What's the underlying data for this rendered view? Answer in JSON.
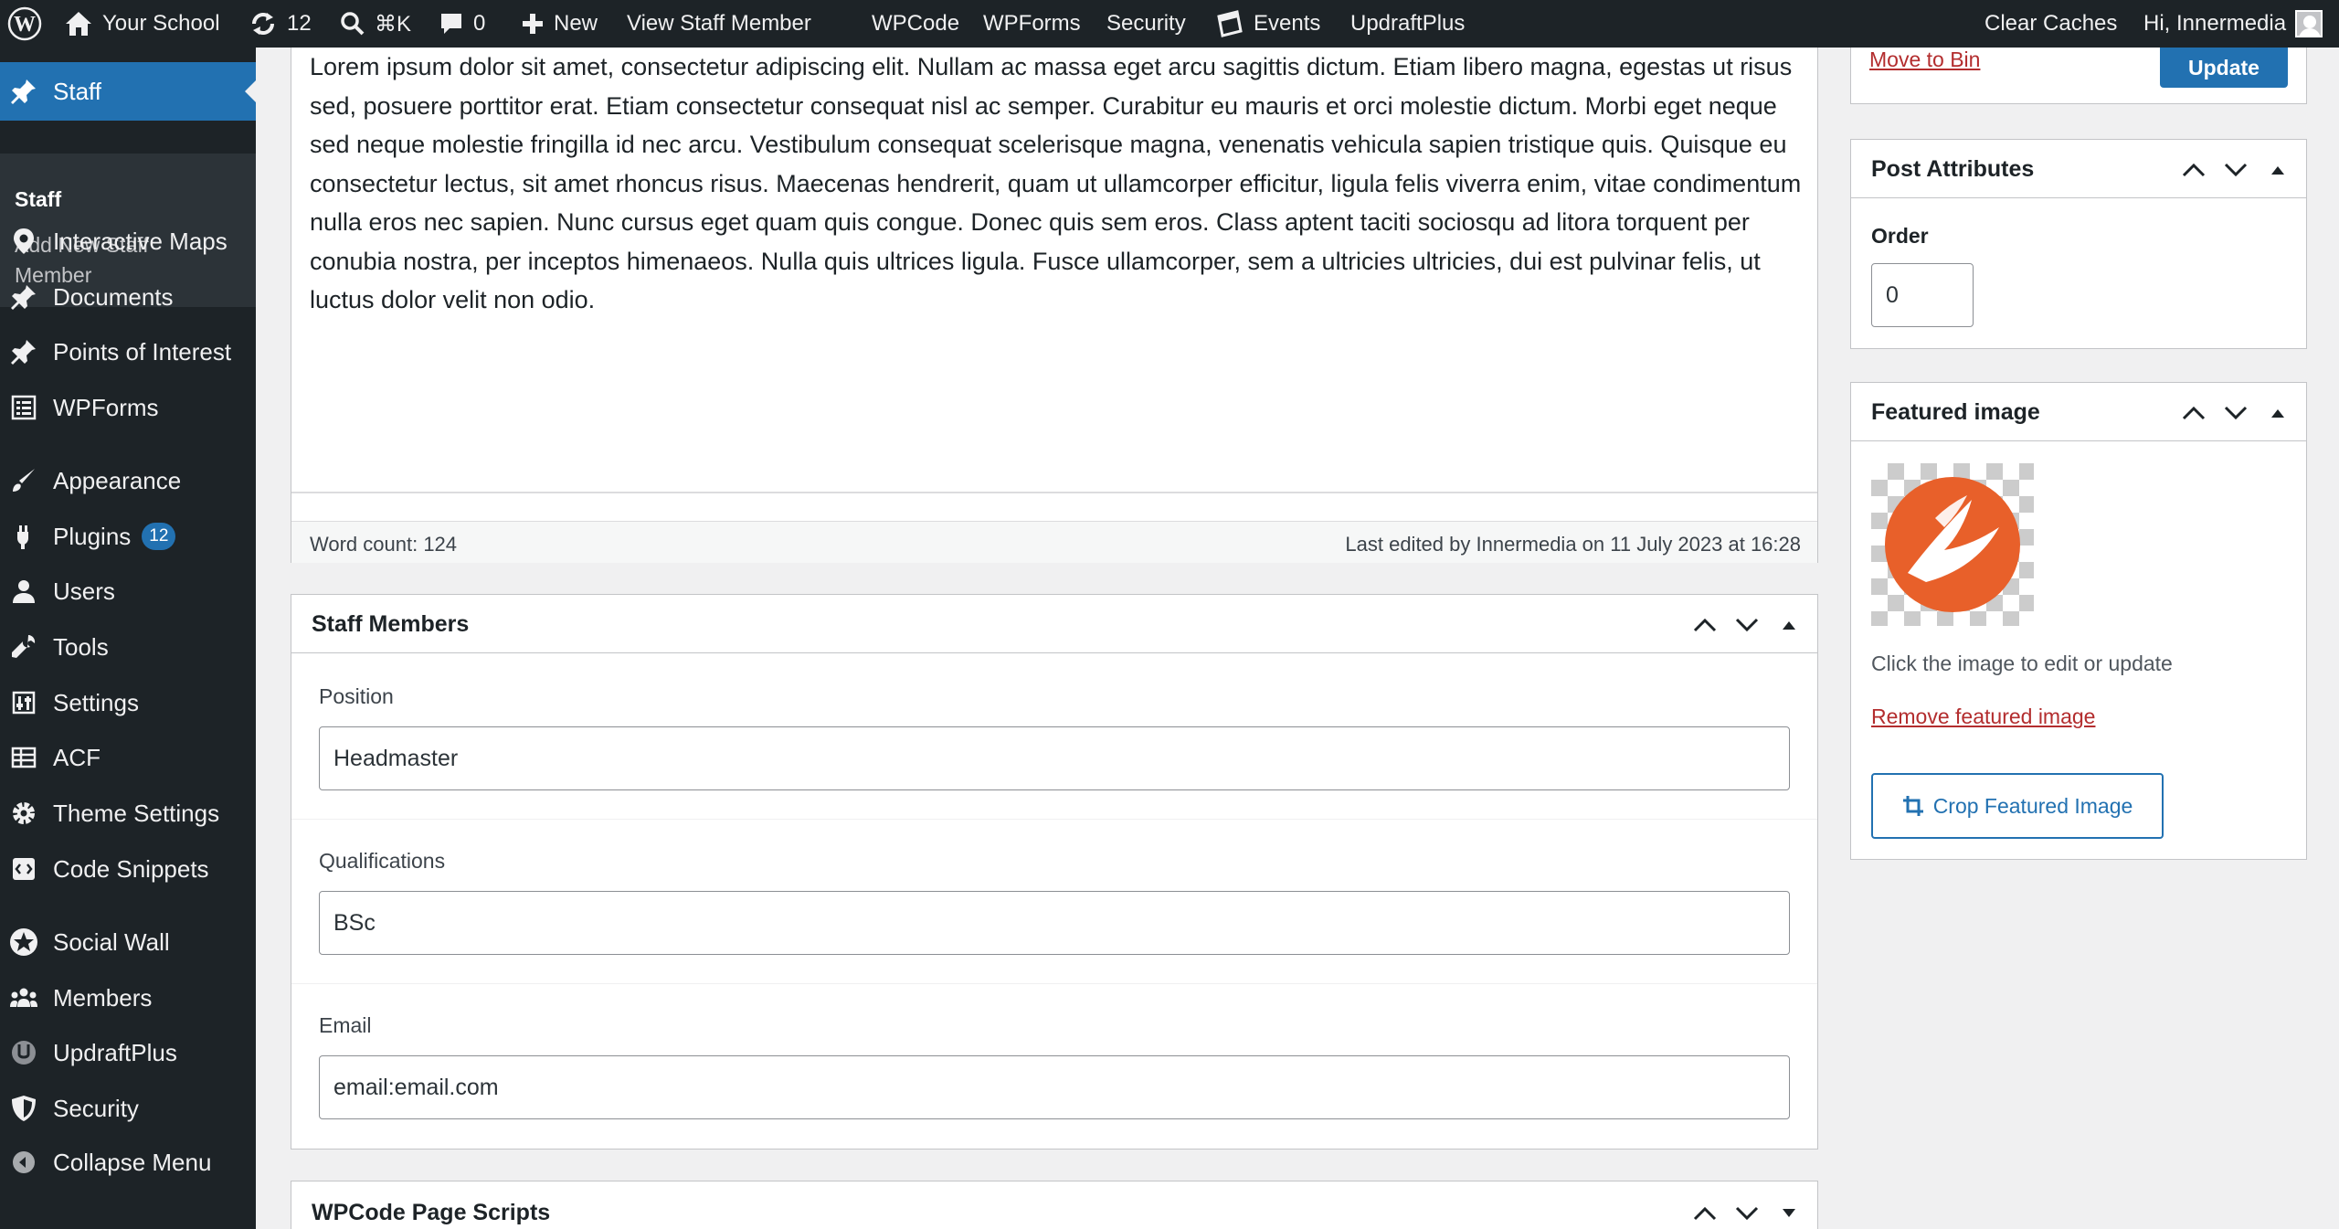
{
  "adminbar": {
    "site_name": "Your School",
    "updates_count": "12",
    "search_shortcut": "⌘K",
    "comments_count": "0",
    "new_label": "New",
    "view_label": "View Staff Member",
    "menu_items": [
      "WPCode",
      "WPForms",
      "Security",
      "Events",
      "UpdraftPlus"
    ],
    "clear_caches": "Clear Caches",
    "greeting": "Hi, Innermedia"
  },
  "sidebar": {
    "current": "Staff",
    "submenu": [
      "Staff",
      "Add New Staff",
      "Member"
    ],
    "items": [
      {
        "label": "Interactive Maps",
        "icon": "map-pin-icon"
      },
      {
        "label": "Documents",
        "icon": "pin-icon"
      },
      {
        "label": "Points of Interest",
        "icon": "pin-icon"
      },
      {
        "label": "WPForms",
        "icon": "form-icon"
      },
      {
        "label": "Appearance",
        "icon": "brush-icon"
      },
      {
        "label": "Plugins",
        "icon": "plugin-icon",
        "badge": "12"
      },
      {
        "label": "Users",
        "icon": "user-icon"
      },
      {
        "label": "Tools",
        "icon": "wrench-icon"
      },
      {
        "label": "Settings",
        "icon": "sliders-icon"
      },
      {
        "label": "ACF",
        "icon": "table-icon"
      },
      {
        "label": "Theme Settings",
        "icon": "gear-icon"
      },
      {
        "label": "Code Snippets",
        "icon": "code-icon"
      },
      {
        "label": "Social Wall",
        "icon": "star-icon"
      },
      {
        "label": "Members",
        "icon": "group-icon"
      },
      {
        "label": "UpdraftPlus",
        "icon": "updraft-icon"
      },
      {
        "label": "Security",
        "icon": "shield-icon"
      },
      {
        "label": "Collapse Menu",
        "icon": "collapse-icon"
      }
    ]
  },
  "editor": {
    "content": "Lorem ipsum dolor sit amet, consectetur adipiscing elit. Nullam ac massa eget arcu sagittis dictum. Etiam libero magna, egestas ut risus sed, posuere porttitor erat. Etiam consectetur consequat nisl ac semper. Curabitur eu mauris et orci molestie dictum. Morbi eget neque sed neque molestie fringilla id nec arcu. Vestibulum consequat scelerisque magna, venenatis vehicula sapien tristique quis. Quisque eu consectetur lectus, sit amet rhoncus risus. Maecenas hendrerit, quam ut ullamcorper efficitur, ligula felis viverra enim, vitae condimentum nulla eros nec sapien. Nunc cursus eget quam quis congue. Donec quis sem eros. Class aptent taciti sociosqu ad litora torquent per conubia nostra, per inceptos himenaeos. Nulla quis ultrices ligula. Fusce ullamcorper, sem a ultricies ultricies, dui est pulvinar felis, ut luctus dolor velit non odio.",
    "word_count": "Word count: 124",
    "last_edited": "Last edited by Innermedia on 11 July 2023 at 16:28"
  },
  "staff_members": {
    "title": "Staff Members",
    "position_label": "Position",
    "position_value": "Headmaster",
    "qualifications_label": "Qualifications",
    "qualifications_value": "BSc",
    "email_label": "Email",
    "email_value": "email:email.com"
  },
  "wpcode": {
    "title": "WPCode Page Scripts"
  },
  "publish": {
    "move_to_bin": "Move to Bin",
    "update": "Update"
  },
  "post_attributes": {
    "title": "Post Attributes",
    "order_label": "Order",
    "order_value": "0"
  },
  "featured_image": {
    "title": "Featured image",
    "hint": "Click the image to edit or update",
    "remove": "Remove featured image",
    "crop": "Crop Featured Image"
  },
  "colors": {
    "accent": "#2271b1",
    "admin_dark": "#1d2327",
    "danger": "#b32d2e",
    "logo_orange": "#e8602a"
  }
}
